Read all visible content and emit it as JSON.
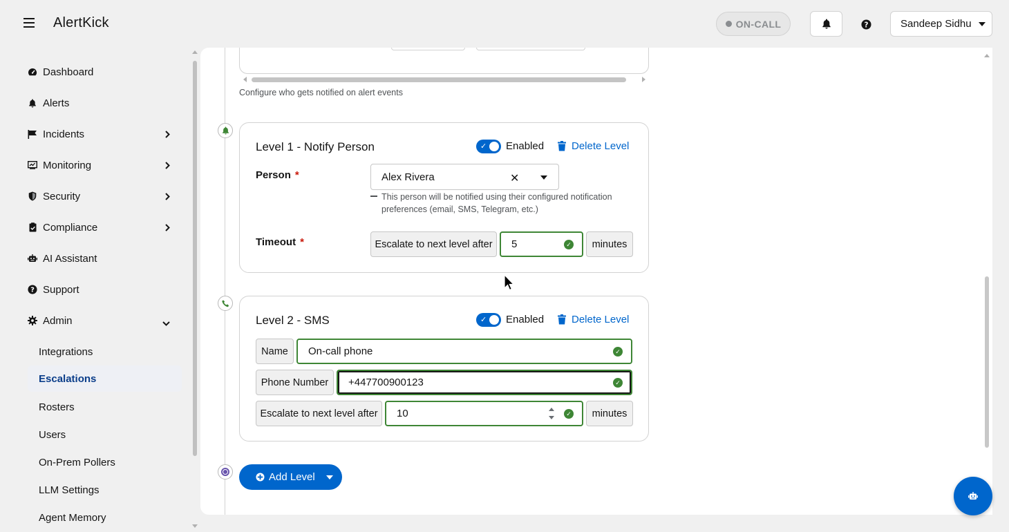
{
  "app": {
    "title": "AlertKick"
  },
  "header": {
    "oncall_label": "ON-CALL",
    "user_name": "Sandeep Sidhu"
  },
  "sidebar": {
    "items": [
      {
        "label": "Dashboard",
        "icon": "dashboard-icon"
      },
      {
        "label": "Alerts",
        "icon": "bell-icon"
      },
      {
        "label": "Incidents",
        "icon": "flag-icon",
        "expandable": true
      },
      {
        "label": "Monitoring",
        "icon": "monitor-icon",
        "expandable": true
      },
      {
        "label": "Security",
        "icon": "shield-icon",
        "expandable": true
      },
      {
        "label": "Compliance",
        "icon": "clipboard-check-icon",
        "expandable": true
      },
      {
        "label": "AI Assistant",
        "icon": "robot-icon"
      },
      {
        "label": "Support",
        "icon": "question-circle-icon"
      },
      {
        "label": "Admin",
        "icon": "gear-icon",
        "expanded": true
      }
    ],
    "admin_subitems": [
      {
        "label": "Integrations"
      },
      {
        "label": "Escalations",
        "active": true
      },
      {
        "label": "Rosters"
      },
      {
        "label": "Users"
      },
      {
        "label": "On-Prem Pollers"
      },
      {
        "label": "LLM Settings"
      },
      {
        "label": "Agent Memory"
      }
    ]
  },
  "main": {
    "config_note": "Configure who gets notified on alert events",
    "level1": {
      "title": "Level 1 - Notify Person",
      "enabled_label": "Enabled",
      "delete_label": "Delete Level",
      "person_label": "Person",
      "required_mark": "*",
      "person_value": "Alex Rivera",
      "person_helper": "This person will be notified using their configured notification preferences (email, SMS, Telegram, etc.)",
      "timeout_label": "Timeout",
      "escalate_label": "Escalate to next level after",
      "timeout_value": "5",
      "minutes_label": "minutes"
    },
    "level2": {
      "title": "Level 2 - SMS",
      "enabled_label": "Enabled",
      "delete_label": "Delete Level",
      "name_label": "Name",
      "name_value": "On-call phone",
      "phone_label": "Phone Number",
      "phone_value": "+447700900123",
      "escalate_label": "Escalate to next level after",
      "escalate_value": "10",
      "minutes_label": "minutes"
    },
    "add_level_label": "Add Level"
  },
  "colors": {
    "primary": "#0066cc",
    "success": "#3e8635",
    "danger": "#c9190b",
    "timeline_bell": "#3e8635",
    "timeline_end": "#6753ac"
  }
}
